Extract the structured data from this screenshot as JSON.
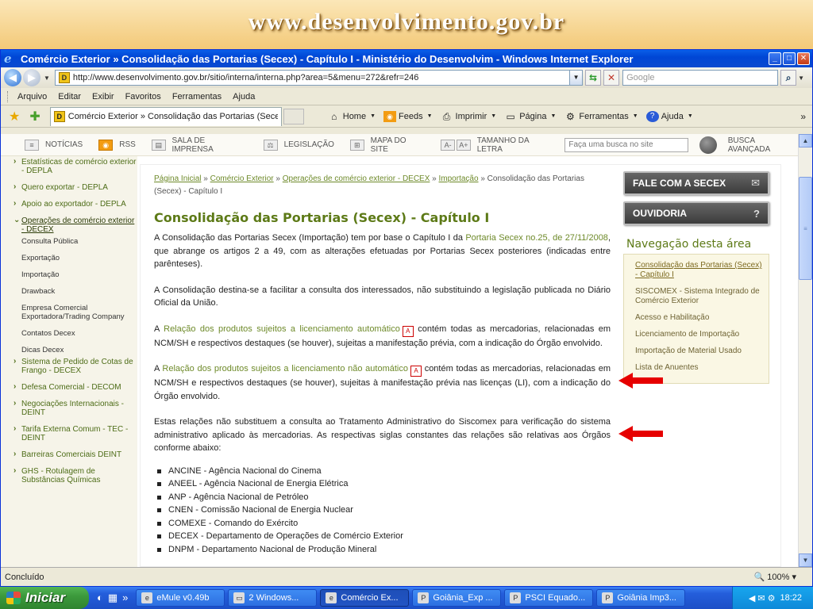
{
  "slide": {
    "header_url": "www.desenvolvimento.gov.br"
  },
  "browser": {
    "title": "Comércio Exterior » Consolidação das Portarias (Secex) - Capítulo I - Ministério do Desenvolvim - Windows Internet Explorer",
    "address": "http://www.desenvolvimento.gov.br/sitio/interna/interna.php?area=5&menu=272&refr=246",
    "search_placeholder": "Google",
    "menu": [
      "Arquivo",
      "Editar",
      "Exibir",
      "Favoritos",
      "Ferramentas",
      "Ajuda"
    ],
    "tab_title": "Comércio Exterior » Consolidação das Portarias (Sece...",
    "commands": {
      "home": "Home",
      "feeds": "Feeds",
      "print": "Imprimir",
      "page": "Página",
      "tools": "Ferramentas",
      "help": "Ajuda"
    },
    "status": "Concluído",
    "zoom": "100%"
  },
  "site": {
    "topnav": {
      "news": "NOTÍCIAS",
      "rss": "RSS",
      "press": "SALA DE IMPRENSA",
      "law": "LEGISLAÇÃO",
      "sitemap": "MAPA DO SITE",
      "font_minus": "A-",
      "font_plus": "A+",
      "font_size": "TAMANHO DA LETRA",
      "search_placeholder": "Faça uma busca no site",
      "advanced": "BUSCA AVANÇADA"
    },
    "leftnav": [
      {
        "label": "Estatísticas de comércio exterior - DEPLA"
      },
      {
        "label": "Quero exportar - DEPLA"
      },
      {
        "label": "Apoio ao exportador - DEPLA"
      },
      {
        "label": "Operações de comércio exterior - DECEX"
      }
    ],
    "leftnav_sub": [
      "Consulta Pública",
      "Exportação",
      "Importação",
      "Drawback",
      "Empresa Comercial Exportadora/Trading Company",
      "Contatos Decex",
      "Dicas Decex"
    ],
    "leftnav_more": [
      {
        "label": "Sistema de Pedido de Cotas de Frango - DECEX"
      },
      {
        "label": "Defesa Comercial - DECOM"
      },
      {
        "label": "Negociações Internacionais - DEINT"
      },
      {
        "label": "Tarifa Externa Comum - TEC - DEINT"
      },
      {
        "label": "Barreiras Comerciais DEINT"
      },
      {
        "label": "GHS - Rotulagem de Substâncias Químicas"
      }
    ],
    "breadcrumb": {
      "home": "Página Inicial",
      "sep": " » ",
      "foreign_trade": "Comércio Exterior",
      "operations": "Operações de comércio exterior - DECEX",
      "import": "Importação",
      "current": "Consolidação das Portarias (Secex) - Capítulo I"
    },
    "heading": "Consolidação das Portarias (Secex) - Capítulo I",
    "p1": {
      "a": "A Consolidação das Portarias Secex (Importação) tem por base o Capítulo I da ",
      "link": "Portaria Secex no.25, de 27/11/2008",
      "b": ", que abrange os artigos 2 a 49, com as alterações efetuadas por Portarias Secex posteriores (indicadas entre parênteses)."
    },
    "p2": "A Consolidação destina-se a facilitar a consulta dos interessados, não substituindo a legislação publicada no Diário Oficial da União.",
    "p3": {
      "a": "A ",
      "link": "Relação dos produtos sujeitos a licenciamento automático",
      "b": " contém todas as mercadorias, relacionadas em NCM/SH e respectivos destaques (se houver), sujeitas a manifestação prévia, com a indicação do Órgão envolvido."
    },
    "p4": {
      "a": "A ",
      "link": "Relação dos produtos sujeitos a licenciamento não automático",
      "b": " contém todas as mercadorias, relacionadas em NCM/SH e respectivos destaques (se houver), sujeitas à manifestação prévia nas licenças (LI), com a indicação do Órgão envolvido."
    },
    "p5": "Estas relações não substituem a consulta ao Tratamento Administrativo do Siscomex para verificação do sistema administrativo aplicado às mercadorias. As respectivas siglas constantes das relações são relativas aos Órgãos conforme abaixo:",
    "agencies": [
      "ANCINE - Agência Nacional do Cinema",
      "ANEEL - Agência Nacional de Energia Elétrica",
      "ANP - Agência Nacional de Petróleo",
      "CNEN - Comissão Nacional de Energia Nuclear",
      "COMEXE - Comando do Exército",
      "DECEX - Departamento de Operações de Comércio Exterior",
      "DNPM - Departamento Nacional de Produção Mineral"
    ],
    "right": {
      "btn1": "FALE COM A SECEX",
      "btn2": "OUVIDORIA",
      "nav_title": "Navegação desta área",
      "nav": [
        "Consolidação das Portarias (Secex) - Capítulo I",
        "SISCOMEX - Sistema Integrado de Comércio Exterior",
        "Acesso e Habilitação",
        "Licenciamento de Importação",
        "Importação de Material Usado",
        "Lista de Anuentes"
      ]
    }
  },
  "taskbar": {
    "start": "Iniciar",
    "tasks": [
      "eMule v0.49b",
      "2 Windows...",
      "Comércio Ex...",
      "Goiânia_Exp ...",
      "PSCI Equado...",
      "Goiânia Imp3..."
    ],
    "clock": "18:22"
  },
  "colors": {
    "accent_green": "#5d7a17",
    "ie_blue": "#0046d5",
    "arrow_red": "#e60000"
  }
}
